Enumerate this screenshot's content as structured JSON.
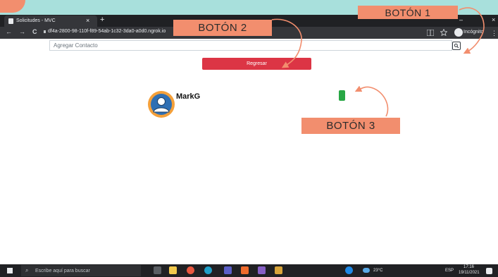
{
  "browser": {
    "tab_title": "Solicitudes - MVC",
    "tab_close": "×",
    "new_tab": "+",
    "nav_back": "←",
    "nav_forward": "→",
    "nav_reload": "C",
    "url": "df4a-2800-98-110f-f89-54ab-1c32-3da0-a0d0.ngrok.io",
    "incognito_label": "Incógnito",
    "menu": "⋮"
  },
  "page": {
    "search_placeholder": "Agregar Contacto",
    "back_button_label": "Regresar",
    "contact_name": "MarkG"
  },
  "annotations": {
    "boton1": "BOTÓN 1",
    "boton2": "BOTÓN 2",
    "boton3": "BOTÓN 3"
  },
  "taskbar": {
    "search_placeholder": "Escribe aquí para buscar",
    "weather": "23°C",
    "language": "ESP",
    "time": "17:16",
    "date": "19/11/2021"
  },
  "colors": {
    "accent_red": "#dc3545",
    "accent_green": "#28a745",
    "annotation": "#f28e6e",
    "background": "#a8e0dc"
  }
}
